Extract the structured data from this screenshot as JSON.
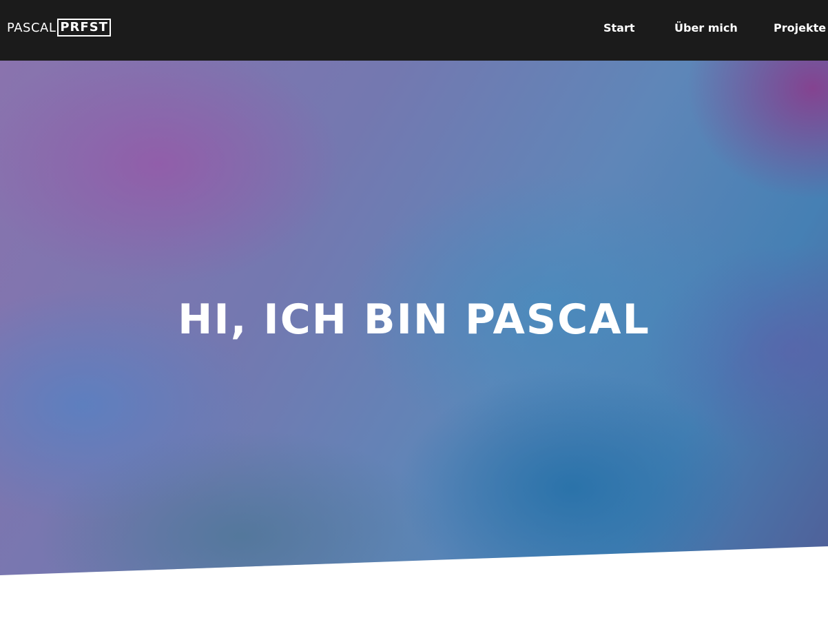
{
  "header": {
    "logo": {
      "first": "PASCAL",
      "boxed": "PRFST"
    },
    "nav": {
      "start": "Start",
      "about": "Über mich",
      "projects": "Projekte"
    }
  },
  "hero": {
    "heading": "HI, ICH BIN PASCAL"
  },
  "colors": {
    "navbar_background": "#1b1b1b",
    "nav_text": "#ffffff",
    "hero_text": "#ffffff",
    "page_background": "#ffffff"
  }
}
